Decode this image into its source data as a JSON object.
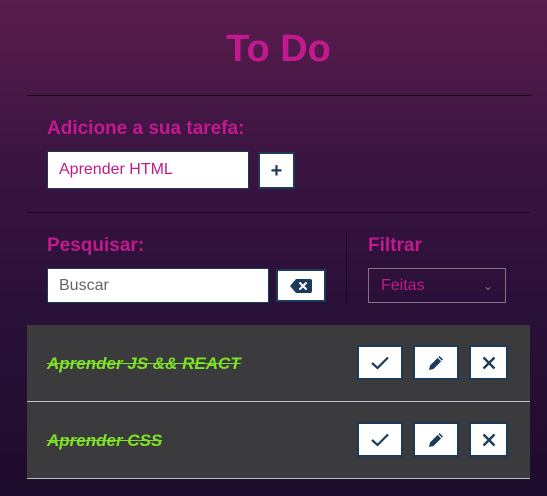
{
  "app": {
    "title": "To Do"
  },
  "add_form": {
    "label": "Adicione a sua tarefa:",
    "input_value": "Aprender HTML",
    "add_button_label": "+"
  },
  "search": {
    "label": "Pesquisar:",
    "placeholder": "Buscar",
    "clear_icon": "backspace-icon"
  },
  "filter": {
    "label": "Filtrar",
    "selected": "Feitas"
  },
  "todos": [
    {
      "text": "Aprender JS && REACT",
      "done": true
    },
    {
      "text": "Aprender CSS",
      "done": true
    }
  ],
  "icons": {
    "done": "check-icon",
    "edit": "pencil-icon",
    "remove": "close-icon"
  },
  "colors": {
    "accent": "#c21a8e",
    "done_text": "#7ee227",
    "button_border": "#1b3a5c",
    "item_bg": "#3b3b3d"
  }
}
